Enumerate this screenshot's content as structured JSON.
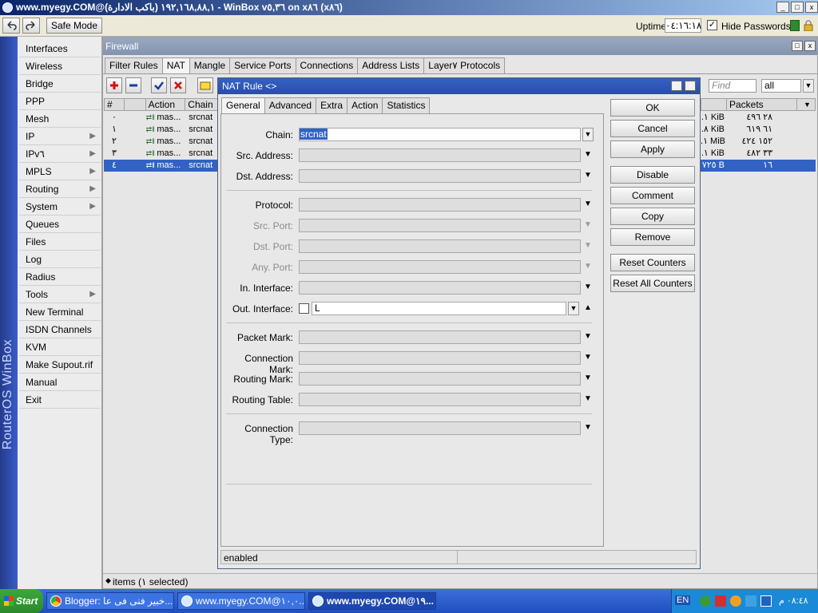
{
  "window": {
    "title": "www.myegy.COM@١٩٢,١٦٨,٨٨,١ (باكب الادارة) - WinBox v٥,٣٦ on x٨٦ (x٨٦)",
    "controls": [
      "_",
      "□",
      "x"
    ]
  },
  "toolbar": {
    "safe_mode": "Safe Mode",
    "uptime_label": "Uptime:",
    "uptime_value": "٠٤:١٦:١٨",
    "hide_passwords": "Hide Passwords"
  },
  "sidebar": {
    "brand": "RouterOS WinBox",
    "items": [
      {
        "label": "Interfaces",
        "sub": false
      },
      {
        "label": "Wireless",
        "sub": false
      },
      {
        "label": "Bridge",
        "sub": false
      },
      {
        "label": "PPP",
        "sub": false
      },
      {
        "label": "Mesh",
        "sub": false
      },
      {
        "label": "IP",
        "sub": true
      },
      {
        "label": "IPv٦",
        "sub": true
      },
      {
        "label": "MPLS",
        "sub": true
      },
      {
        "label": "Routing",
        "sub": true
      },
      {
        "label": "System",
        "sub": true
      },
      {
        "label": "Queues",
        "sub": false
      },
      {
        "label": "Files",
        "sub": false
      },
      {
        "label": "Log",
        "sub": false
      },
      {
        "label": "Radius",
        "sub": false
      },
      {
        "label": "Tools",
        "sub": true
      },
      {
        "label": "New Terminal",
        "sub": false
      },
      {
        "label": "ISDN Channels",
        "sub": false
      },
      {
        "label": "KVM",
        "sub": false
      },
      {
        "label": "Make Supout.rif",
        "sub": false
      },
      {
        "label": "Manual",
        "sub": false
      },
      {
        "label": "Exit",
        "sub": false
      }
    ]
  },
  "firewall": {
    "title": "Firewall",
    "tabs": [
      "Filter Rules",
      "NAT",
      "Mangle",
      "Service Ports",
      "Connections",
      "Address Lists",
      "Layer٧ Protocols"
    ],
    "find_placeholder": "Find",
    "filter_value": "all",
    "columns": {
      "num": "#",
      "action": "Action",
      "chain": "Chain",
      "packets": "Packets"
    },
    "rows": [
      {
        "num": "٠",
        "action": "mas...",
        "chain": "srcnat",
        "bytes": ".١ KiB",
        "packets": "٢٨ ٤٩٦"
      },
      {
        "num": "١",
        "action": "mas...",
        "chain": "srcnat",
        "bytes": ".٨ KiB",
        "packets": "٦١ ٦١٩"
      },
      {
        "num": "٢",
        "action": "mas...",
        "chain": "srcnat",
        "bytes": ".١ MiB",
        "packets": "١٥٢ ٤٢٤"
      },
      {
        "num": "٣",
        "action": "mas...",
        "chain": "srcnat",
        "bytes": ".١ KiB",
        "packets": "٣٣ ٤٨٢"
      },
      {
        "num": "٤",
        "action": "mas...",
        "chain": "srcnat",
        "bytes": "٧٢٥ B",
        "packets": "١٦"
      }
    ],
    "status": "items (١ selected)"
  },
  "dialog": {
    "title": "NAT Rule <>",
    "tabs": [
      "General",
      "Advanced",
      "Extra",
      "Action",
      "Statistics"
    ],
    "fields": {
      "chain": {
        "label": "Chain:",
        "value": "srcnat"
      },
      "src_address": {
        "label": "Src. Address:"
      },
      "dst_address": {
        "label": "Dst. Address:"
      },
      "protocol": {
        "label": "Protocol:"
      },
      "src_port": {
        "label": "Src. Port:"
      },
      "dst_port": {
        "label": "Dst. Port:"
      },
      "any_port": {
        "label": "Any. Port:"
      },
      "in_interface": {
        "label": "In. Interface:"
      },
      "out_interface": {
        "label": "Out. Interface:",
        "value": "L"
      },
      "packet_mark": {
        "label": "Packet Mark:"
      },
      "connection_mark": {
        "label": "Connection Mark:"
      },
      "routing_mark": {
        "label": "Routing Mark:"
      },
      "routing_table": {
        "label": "Routing Table:"
      },
      "connection_type": {
        "label": "Connection Type:"
      }
    },
    "buttons": [
      "OK",
      "Cancel",
      "Apply",
      "Disable",
      "Comment",
      "Copy",
      "Remove",
      "Reset Counters",
      "Reset All Counters"
    ],
    "status": "enabled"
  },
  "taskbar": {
    "start": "Start",
    "tasks": [
      "Blogger: خبير فنى فى عا...",
      "www.myegy.COM@١٠,٠...",
      "www.myegy.COM@١٩..."
    ],
    "lang": "EN",
    "clock": "٠٨:٤٨ م"
  },
  "colors": {
    "titlebar": "#0a246a",
    "selection": "#3162c4",
    "dialog_title": "#2f5bbd"
  }
}
